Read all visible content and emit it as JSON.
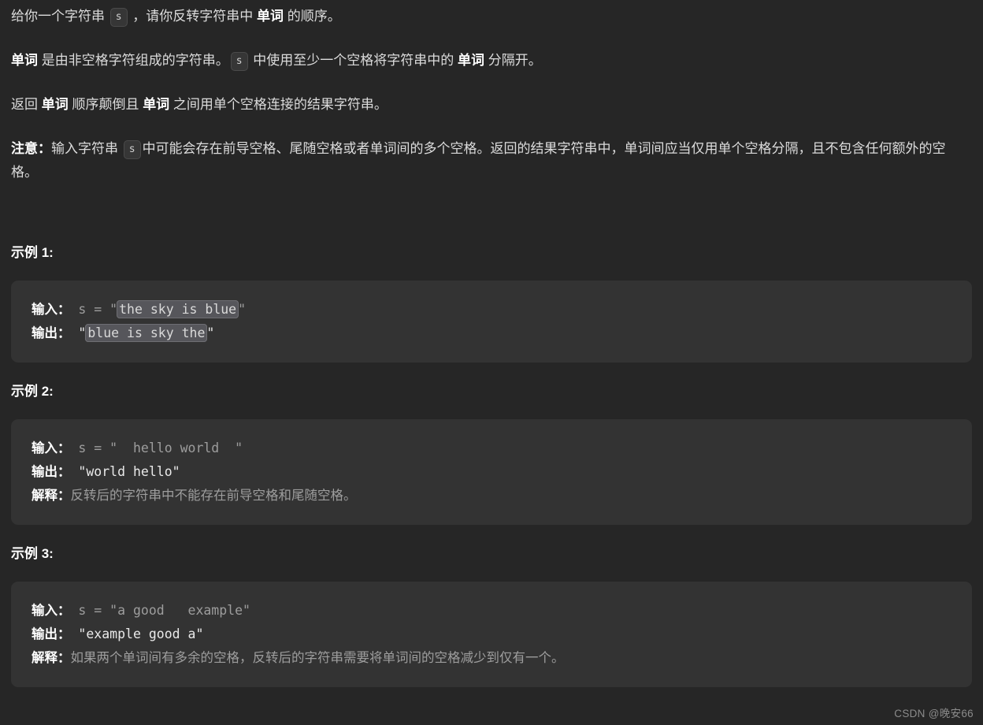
{
  "page": {
    "background_color": "#262626",
    "code_block_color": "#333333",
    "text_color": "#dcdcdc",
    "highlight_color": "#56565b"
  },
  "intro": {
    "p1": {
      "seg1": "给你一个字符串 ",
      "code1": "s",
      "seg2": " ，请你反转字符串中 ",
      "bold1": "单词",
      "seg3": " 的顺序。"
    },
    "p2": {
      "bold1": "单词",
      "seg1": " 是由非空格字符组成的字符串。",
      "code1": "s",
      "seg2": " 中使用至少一个空格将字符串中的 ",
      "bold2": "单词",
      "seg3": " 分隔开。"
    },
    "p3": {
      "seg1": "返回 ",
      "bold1": "单词",
      "seg2": " 顺序颠倒且 ",
      "bold2": "单词",
      "seg3": " 之间用单个空格连接的结果字符串。"
    },
    "p4": {
      "bold1": "注意：",
      "seg1": "输入字符串 ",
      "code1": "s",
      "seg2": "中可能会存在前导空格、尾随空格或者单词间的多个空格。返回的结果字符串中，单词间应当仅用单个空格分隔，且不包含任何额外的空格。"
    }
  },
  "examples": [
    {
      "heading": "示例 1:",
      "lines": [
        {
          "label": "输入：",
          "prefix": " s = \"",
          "highlight": "the sky is blue",
          "suffix": "\"",
          "style": "dim"
        },
        {
          "label": "输出：",
          "prefix": " \"",
          "highlight": "blue is sky the",
          "suffix": "\"",
          "style": "bright"
        }
      ]
    },
    {
      "heading": "示例 2:",
      "lines": [
        {
          "label": "输入：",
          "text": " s = \"  hello world  \"",
          "style": "dim"
        },
        {
          "label": "输出：",
          "text": " \"world hello\"",
          "style": "bright"
        },
        {
          "label": "解释：",
          "text": "反转后的字符串中不能存在前导空格和尾随空格。",
          "style": "cn"
        }
      ]
    },
    {
      "heading": "示例 3:",
      "lines": [
        {
          "label": "输入：",
          "text": " s = \"a good   example\"",
          "style": "dim"
        },
        {
          "label": "输出：",
          "text": " \"example good a\"",
          "style": "bright"
        },
        {
          "label": "解释：",
          "text": "如果两个单词间有多余的空格，反转后的字符串需要将单词间的空格减少到仅有一个。",
          "style": "cn"
        }
      ]
    }
  ],
  "watermark": {
    "text": "CSDN @晚安66"
  }
}
